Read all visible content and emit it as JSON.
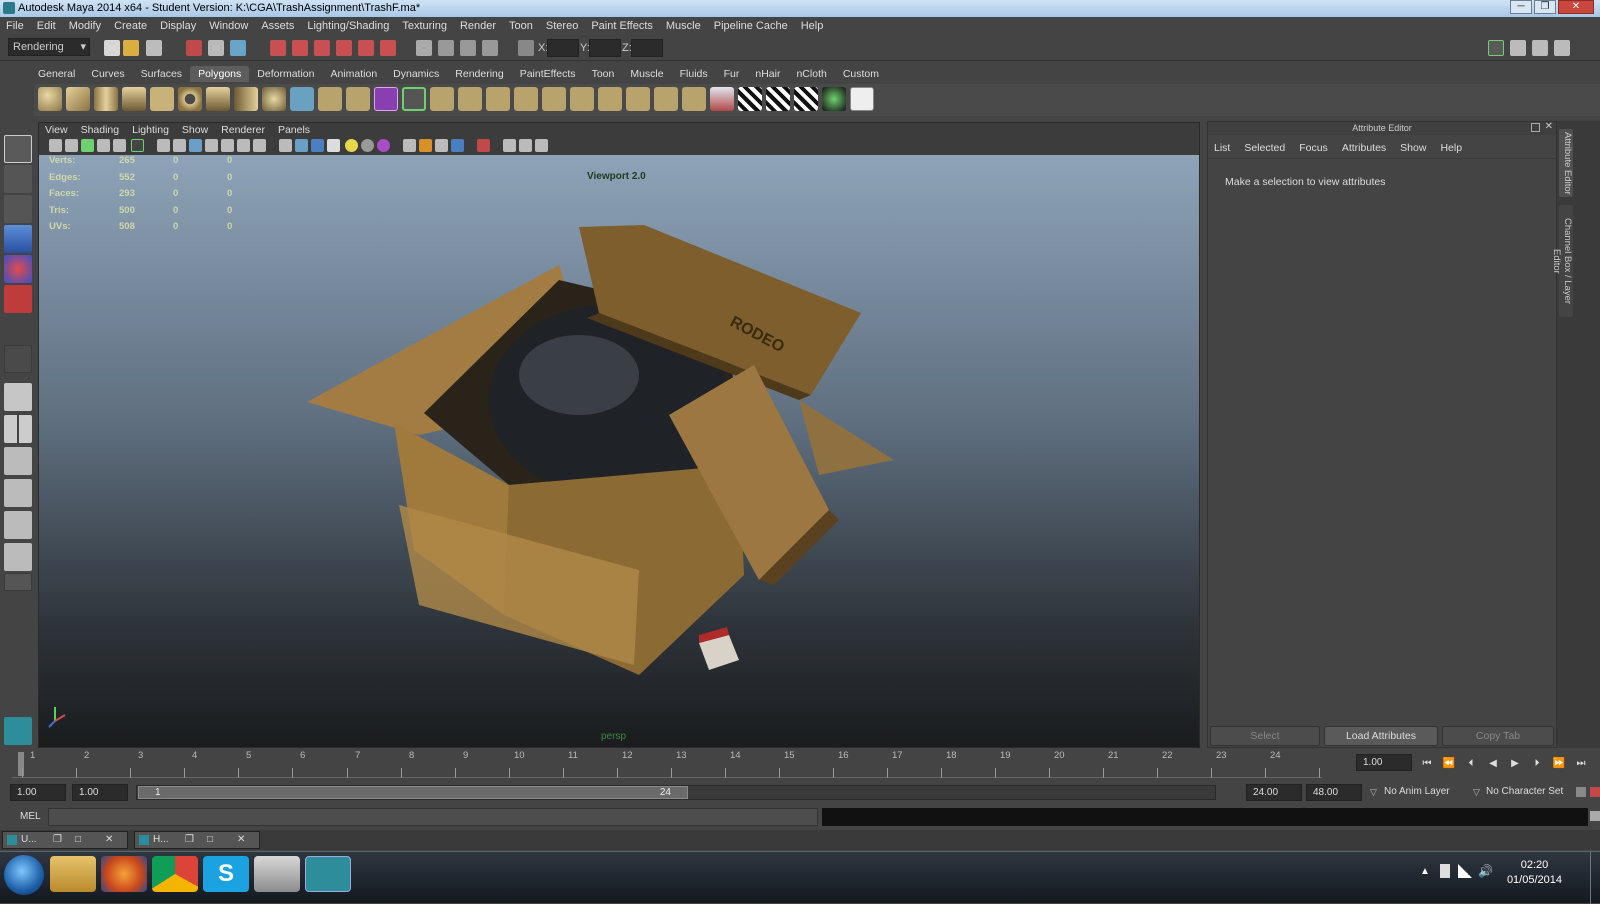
{
  "window": {
    "title": "Autodesk Maya 2014 x64 - Student Version: K:\\CGA\\TrashAssignment\\TrashF.ma*",
    "min": "─",
    "max": "❐",
    "close": "✕"
  },
  "menubar": [
    "File",
    "Edit",
    "Modify",
    "Create",
    "Display",
    "Window",
    "Assets",
    "Lighting/Shading",
    "Texturing",
    "Render",
    "Toon",
    "Stereo",
    "Paint Effects",
    "Muscle",
    "Pipeline Cache",
    "Help"
  ],
  "statusline": {
    "menuset": "Rendering",
    "x_label": "X:",
    "y_label": "Y:",
    "z_label": "Z:"
  },
  "shelf_tabs": [
    "General",
    "Curves",
    "Surfaces",
    "Polygons",
    "Deformation",
    "Animation",
    "Dynamics",
    "Rendering",
    "PaintEffects",
    "Toon",
    "Muscle",
    "Fluids",
    "Fur",
    "nHair",
    "nCloth",
    "Custom"
  ],
  "shelf_active": "Polygons",
  "panel_menu": [
    "View",
    "Shading",
    "Lighting",
    "Show",
    "Renderer",
    "Panels"
  ],
  "hud": {
    "rows": [
      {
        "label": "Verts:",
        "a": "265",
        "b": "0",
        "c": "0"
      },
      {
        "label": "Edges:",
        "a": "552",
        "b": "0",
        "c": "0"
      },
      {
        "label": "Faces:",
        "a": "293",
        "b": "0",
        "c": "0"
      },
      {
        "label": "Tris:",
        "a": "500",
        "b": "0",
        "c": "0"
      },
      {
        "label": "UVs:",
        "a": "508",
        "b": "0",
        "c": "0"
      }
    ]
  },
  "viewport": {
    "renderer_label": "Viewport 2.0",
    "camera": "persp",
    "box_print": "RODEO"
  },
  "attribute_editor": {
    "title": "Attribute Editor",
    "menu": [
      "List",
      "Selected",
      "Focus",
      "Attributes",
      "Show",
      "Help"
    ],
    "message": "Make a selection to view attributes",
    "buttons": {
      "select": "Select",
      "load": "Load Attributes",
      "copy": "Copy Tab"
    }
  },
  "side_tabs": {
    "attr": "Attribute Editor",
    "channel": "Channel Box / Layer Editor"
  },
  "timeline": {
    "ticks": [
      "1",
      "2",
      "3",
      "4",
      "5",
      "6",
      "7",
      "8",
      "9",
      "10",
      "11",
      "12",
      "13",
      "14",
      "15",
      "16",
      "17",
      "18",
      "19",
      "20",
      "21",
      "22",
      "23",
      "24"
    ],
    "current": "1.00"
  },
  "range": {
    "start": "1.00",
    "playback_start": "1.00",
    "range_start": "1",
    "range_end": "24",
    "playback_end": "24.00",
    "end": "48.00",
    "anim_layer": "No Anim Layer",
    "character_set": "No Character Set"
  },
  "cmdline": {
    "label": "MEL"
  },
  "minimized": [
    {
      "label": "U..."
    },
    {
      "label": "H..."
    }
  ],
  "clock": {
    "time": "02:20",
    "date": "01/05/2014"
  },
  "colors": {
    "accent": "#5d5d5d",
    "viewport_top": "#8ea3b8",
    "viewport_bottom": "#1a1c1e",
    "hud_text": "#cfd8a8",
    "cardboard": "#8c6a33"
  }
}
